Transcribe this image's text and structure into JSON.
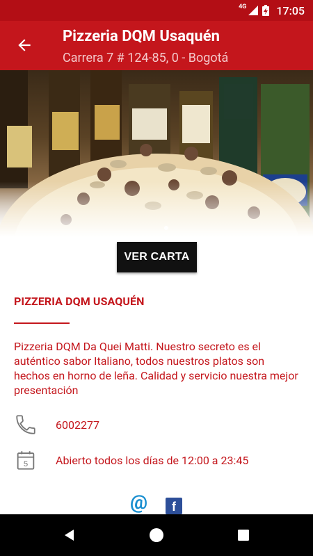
{
  "status_bar": {
    "network": "4G",
    "time": "17:05",
    "icons": [
      "signal-icon",
      "battery-charging-icon"
    ]
  },
  "app_bar": {
    "title": "Pizzeria DQM Usaquén",
    "subtitle": "Carrera 7 # 124-85, 0 - Bogotá",
    "back_icon": "arrow-back-icon"
  },
  "hero": {
    "image": "pizza-and-beer-bottles"
  },
  "actions": {
    "menu_button_label": "VER CARTA"
  },
  "details": {
    "name": "PIZZERIA DQM USAQUÉN",
    "description": "Pizzeria DQM Da Quei Matti. Nuestro secreto es el auténtico sabor Italiano, todos nuestros platos son hechos en horno de leña. Calidad y servicio nuestra mejor presentación",
    "phone": "6002277",
    "hours": "Abierto todos los días de 12:00 a 23:45",
    "phone_icon": "phone-icon",
    "hours_icon": "calendar-icon"
  },
  "social": {
    "email_icon": "at-icon",
    "email_glyph": "@",
    "facebook_icon": "facebook-icon",
    "facebook_glyph": "f"
  },
  "colors": {
    "accent": "#c4161c",
    "status_bar": "#b30e15",
    "button": "#111111",
    "facebook": "#2d4f99",
    "email": "#1a8fd0"
  }
}
